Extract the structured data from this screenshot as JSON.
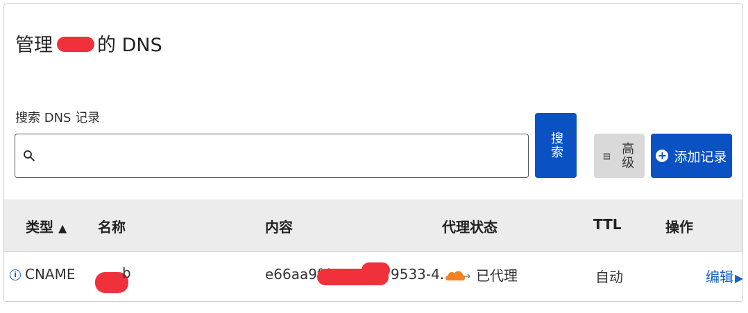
{
  "header": {
    "title_prefix": "管理",
    "title_suffix": "的 DNS"
  },
  "search": {
    "label": "搜索 DNS 记录",
    "placeholder": "",
    "value": "",
    "button_label": "搜索"
  },
  "toolbar": {
    "advanced_label": "高级",
    "add_record_label": "添加记录"
  },
  "table": {
    "columns": [
      "类型",
      "名称",
      "内容",
      "代理状态",
      "TTL",
      "操作"
    ],
    "sort_indicator": "▲",
    "rows": [
      {
        "type": "CNAME",
        "name_visible": "b",
        "content_prefix": "e66aa9fd",
        "content_suffix": "9533-4...",
        "proxy_status": "已代理",
        "ttl": "自动",
        "action": "编辑"
      }
    ]
  },
  "colors": {
    "primary": "#0a51c3",
    "advanced_bg": "#d9d9d9",
    "table_head_bg": "#ececec",
    "redaction": "#f0303a",
    "cloud": "#f48120",
    "link": "#1a5fc8"
  }
}
